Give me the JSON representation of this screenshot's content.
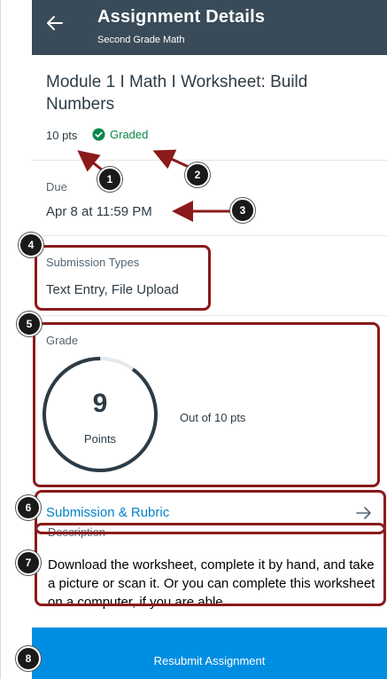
{
  "header": {
    "title": "Assignment Details",
    "subtitle": "Second Grade Math"
  },
  "assignment": {
    "title": "Module 1 I Math I Worksheet: Build Numbers",
    "points": "10 pts",
    "status": "Graded"
  },
  "due": {
    "label": "Due",
    "value": "Apr 8 at 11:59 PM"
  },
  "submission_types": {
    "label": "Submission Types",
    "value": "Text Entry, File Upload"
  },
  "grade": {
    "label": "Grade",
    "score": "9",
    "unit": "Points",
    "out_of": "Out of 10 pts",
    "fraction": 0.9
  },
  "rubric": {
    "label": "Submission & Rubric"
  },
  "description": {
    "label": "Description",
    "text": "Download the worksheet, complete it by hand, and take a picture or scan it. Or you can complete this worksheet on a computer, if you are able."
  },
  "resubmit_label": "Resubmit Assignment",
  "annotations": [
    "1",
    "2",
    "3",
    "4",
    "5",
    "6",
    "7",
    "8"
  ],
  "colors": {
    "header": "#394b58",
    "accent": "#008ee2",
    "graded": "#0b874b",
    "link": "#0081c8",
    "annotation": "#8b1a1a"
  }
}
